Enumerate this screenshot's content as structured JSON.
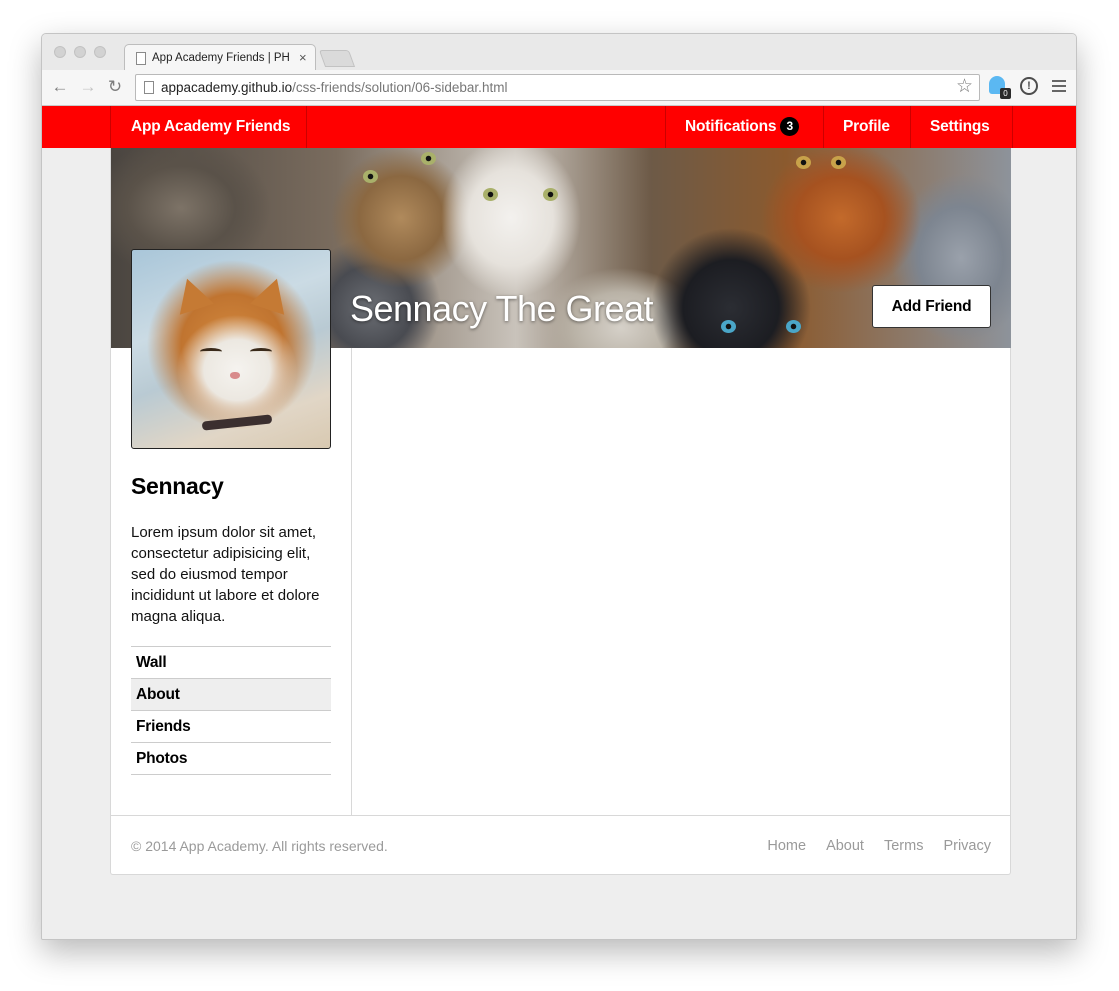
{
  "browser": {
    "tab_title": "App Academy Friends | PH",
    "tab_close": "×",
    "url_host": "appacademy.github.io",
    "url_path": "/css-friends/solution/06-sidebar.html",
    "back_glyph": "←",
    "forward_glyph": "→",
    "reload_glyph": "↻",
    "star_glyph": "☆",
    "extension_badge": "0",
    "info_glyph": "!"
  },
  "nav": {
    "brand": "App Academy Friends",
    "notifications_label": "Notifications",
    "notifications_count": "3",
    "profile_label": "Profile",
    "settings_label": "Settings"
  },
  "cover": {
    "name": "Sennacy The Great",
    "add_friend_label": "Add Friend"
  },
  "profile": {
    "name": "Sennacy",
    "bio": "Lorem ipsum dolor sit amet, consectetur adipisicing elit, sed do eiusmod tempor incididunt ut labore et dolore magna aliqua."
  },
  "sidebar": {
    "items": [
      {
        "label": "Wall",
        "active": false
      },
      {
        "label": "About",
        "active": true
      },
      {
        "label": "Friends",
        "active": false
      },
      {
        "label": "Photos",
        "active": false
      }
    ]
  },
  "footer": {
    "copyright": "© 2014 App Academy. All rights reserved.",
    "links": [
      "Home",
      "About",
      "Terms",
      "Privacy"
    ]
  },
  "colors": {
    "navbar": "#ff0000",
    "badge": "#000000",
    "active_nav": "#eeeeee",
    "footer_text": "#9a9a9a"
  },
  "icons": [
    "page-icon",
    "back-arrow-icon",
    "forward-arrow-icon",
    "reload-icon",
    "star-icon",
    "ghostery-icon",
    "info-icon",
    "menu-icon"
  ]
}
